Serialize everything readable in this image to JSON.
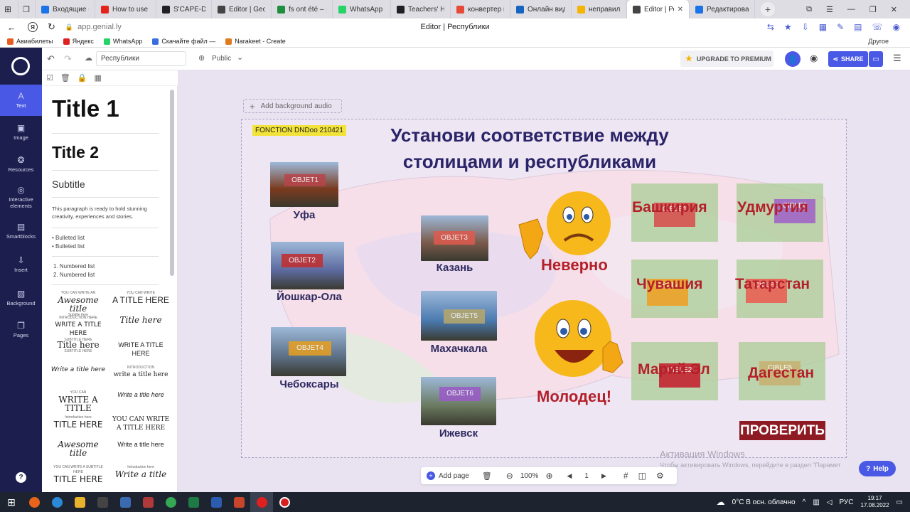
{
  "browser": {
    "tabs": [
      {
        "label": "Входящие - Г",
        "color": "#1a73e8"
      },
      {
        "label": "How to use S",
        "color": "#e62117"
      },
      {
        "label": "S'CAPE-DND",
        "color": "#202124"
      },
      {
        "label": "Editor | Georg",
        "color": "#444444"
      },
      {
        "label": "fs ont été – ne",
        "color": "#1e8e3e"
      },
      {
        "label": "WhatsApp",
        "color": "#25d366"
      },
      {
        "label": "Teachers' Hap",
        "color": "#202124"
      },
      {
        "label": "конвертер ви",
        "color": "#e84a3a"
      },
      {
        "label": "Онлайн виде",
        "color": "#1565c0"
      },
      {
        "label": "неправильно",
        "color": "#f4b400"
      },
      {
        "label": "Editor | Рес",
        "color": "#444444"
      },
      {
        "label": "Редактироват",
        "color": "#1a73e8"
      }
    ],
    "page_title": "Editor | Республики",
    "url": "app.genial.ly",
    "other_bookmarks": "Другое",
    "bookmarks": [
      {
        "label": "Авиабилеты",
        "color": "#e85d1f"
      },
      {
        "label": "Яндекс",
        "color": "#e02020"
      },
      {
        "label": "WhatsApp",
        "color": "#25d366"
      },
      {
        "label": "Скачайте файл —",
        "color": "#3a6de0"
      },
      {
        "label": "Narakeet - Create",
        "color": "#e07a1f"
      }
    ]
  },
  "toolbar": {
    "doc_name": "Республики",
    "visibility": "Public",
    "upgrade_label": "UPGRADE TO PREMIUM",
    "share_label": "SHARE"
  },
  "rail": [
    {
      "label": "Text",
      "icon": "A"
    },
    {
      "label": "Image",
      "icon": "▣"
    },
    {
      "label": "Resources",
      "icon": "❂"
    },
    {
      "label": "Interactive elements",
      "icon": "◎"
    },
    {
      "label": "Smartblocks",
      "icon": "▤"
    },
    {
      "label": "Insert",
      "icon": "⇩"
    },
    {
      "label": "Background",
      "icon": "▧"
    },
    {
      "label": "Pages",
      "icon": "❐"
    }
  ],
  "panel": {
    "title1": "Title 1",
    "title2": "Title 2",
    "subtitle": "Subtitle",
    "paragraph": "This paragraph is ready to hold stunning creativity, experiences and stories.",
    "bullets": [
      "Bulleted list",
      "Bulleted list"
    ],
    "numbers": [
      "1. Numbered list",
      "2. Numbered list"
    ],
    "styles": [
      {
        "small": "YOU CAN WRITE AN",
        "big": "Awesome title",
        "foot": "Subtitle here"
      },
      {
        "small": "YOU CAN WRITE",
        "big": "A TITLE HERE",
        "foot": ""
      },
      {
        "small": "INTRODUCTION HERE",
        "big": "WRITE A TITLE HERE",
        "foot": "SUBTITLE HERE"
      },
      {
        "small": "",
        "big": "Title here",
        "foot": ""
      },
      {
        "small": "",
        "big": "Title here",
        "foot": "SUBTITLE HERE"
      },
      {
        "small": "",
        "big": "WRITE A TITLE HERE",
        "foot": ""
      },
      {
        "small": "",
        "big": "Write a title here",
        "foot": ""
      },
      {
        "small": "INTRODUCTION",
        "big": "write a title here",
        "foot": ""
      },
      {
        "small": "YOU CAN",
        "big": "WRITE A TITLE",
        "foot": ""
      },
      {
        "small": "",
        "big": "Write a title here",
        "foot": ""
      },
      {
        "small": "Introduction here",
        "big": "TITLE HERE",
        "foot": ""
      },
      {
        "small": "",
        "big": "YOU CAN WRITE A TITLE HERE",
        "foot": ""
      },
      {
        "small": "",
        "big": "Awesome title",
        "foot": ""
      },
      {
        "small": "",
        "big": "Write a title here",
        "foot": ""
      },
      {
        "small": "YOU CAN WRITE A SUBTITLE HERE",
        "big": "TITLE HERE",
        "foot": ""
      },
      {
        "small": "Introduction here",
        "big": "Write a title",
        "foot": ""
      }
    ]
  },
  "canvas": {
    "add_audio": "Add background audio",
    "tag": "FONCTION DNDoo 210421",
    "heading_line1": "Установи соответствие между",
    "heading_line2": "столицами и республиками",
    "wrong": "Неверно",
    "right": "Молодец!",
    "check_button": "ПРОВЕРИТЬ",
    "objects": [
      {
        "tag": "OBJET1",
        "city": "Уфа",
        "img": "#7a3a1e",
        "tagColor": "#b8444a"
      },
      {
        "tag": "OBJET2",
        "city": "Йошкар-Ола",
        "img": "#5d6aa0",
        "tagColor": "#c22d2d"
      },
      {
        "tag": "OBJET3",
        "city": "Казань",
        "img": "#7a5a4a",
        "tagColor": "#e05a4e"
      },
      {
        "tag": "OBJET4",
        "city": "Чебоксары",
        "img": "#5c7086",
        "tagColor": "#e8a020"
      },
      {
        "tag": "OBJET5",
        "city": "Махачкала",
        "img": "#4a7ab0",
        "tagColor": "#b8a86a"
      },
      {
        "tag": "OBJET6",
        "city": "Ижевск",
        "img": "#6a7a60",
        "tagColor": "#9a5ac8"
      }
    ],
    "targets": [
      {
        "name": "Башкирия",
        "tag": "CIBLE1",
        "tagColor": "#d94a4a"
      },
      {
        "name": "Удмуртия",
        "tag": "CIBLE6",
        "tagColor": "#a060c8"
      },
      {
        "name": "Чувашия",
        "tag": "CIBLE4",
        "tagColor": "#f0a020"
      },
      {
        "name": "Татарстан",
        "tag": "CIBLE3",
        "tagColor": "#ec5a50"
      },
      {
        "name": "Марий Эл",
        "tag": "CIBLE2",
        "tagColor": "#c41a2a"
      },
      {
        "name": "Дагестан",
        "tag": "CIBLE5",
        "tagColor": "#c8b070"
      }
    ]
  },
  "bottombar": {
    "add_page": "Add page",
    "zoom": "100%",
    "page_num": "1",
    "help": "Help"
  },
  "watermark": {
    "line1": "Активация Windows",
    "line2": "Чтобы активировать Windows, перейдите в раздел \"Парамет"
  },
  "taskbar": {
    "weather": "0°C  В осн. облачно",
    "lang": "РУС",
    "time": "19:17",
    "date": "17.08.2022"
  }
}
